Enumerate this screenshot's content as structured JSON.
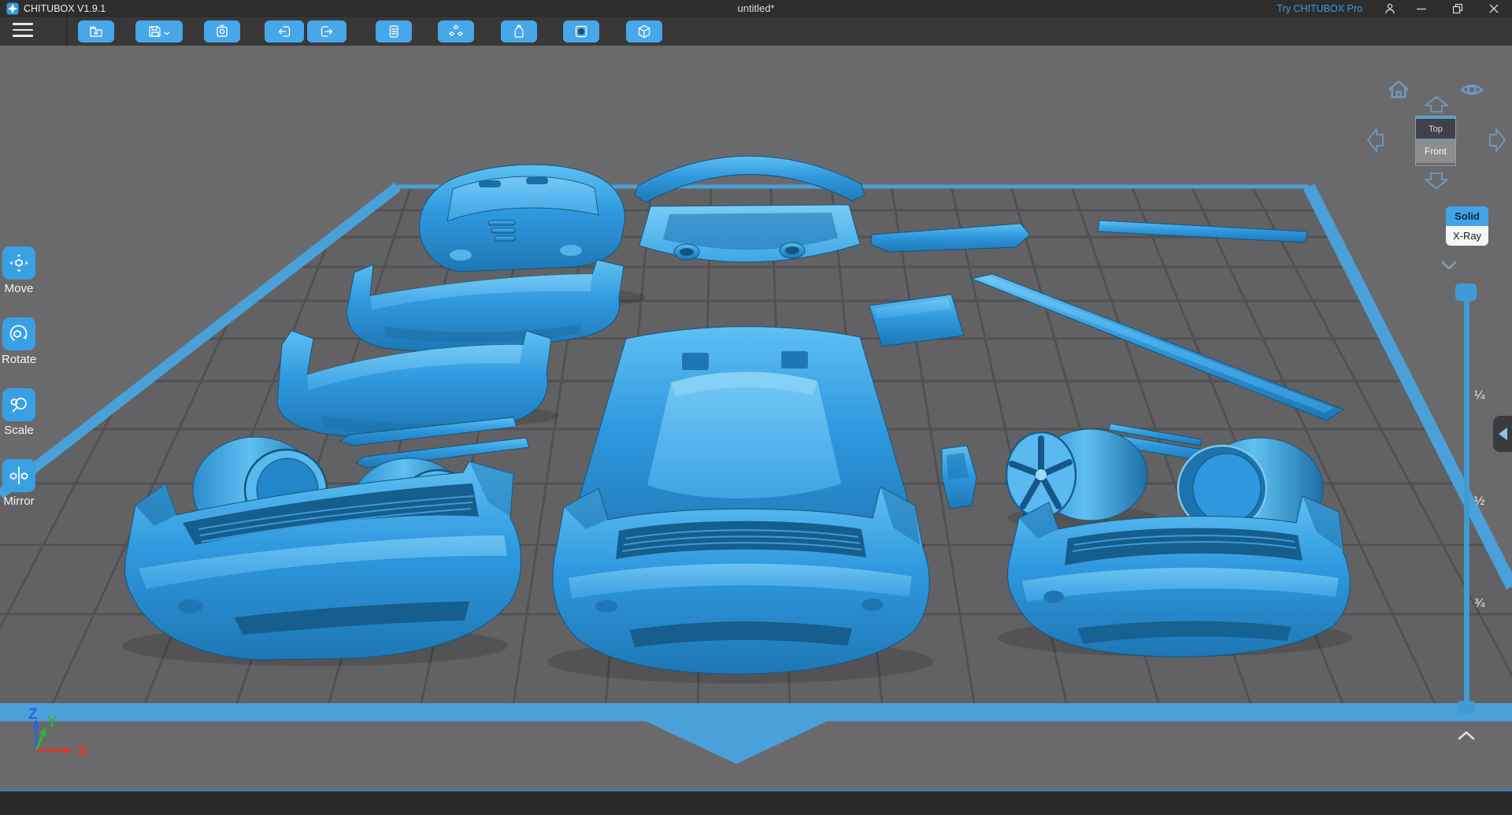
{
  "titlebar": {
    "app_title": "CHITUBOX V1.9.1",
    "document_title": "untitled*",
    "try_pro": "Try CHITUBOX Pro",
    "window_icons": [
      "account-icon",
      "minimize-icon",
      "restore-icon",
      "close-icon"
    ]
  },
  "toolbar": {
    "menu_icon": "hamburger-icon",
    "buttons": [
      {
        "icon": "open-folder-icon"
      },
      {
        "icon": "save-icon-with-dropdown"
      },
      {
        "icon": "screenshot-icon"
      },
      {
        "icon": "undo-icon"
      },
      {
        "icon": "redo-icon"
      },
      {
        "icon": "copy-icon"
      },
      {
        "icon": "auto-layout-icon"
      },
      {
        "icon": "resin-bottle-icon"
      },
      {
        "icon": "dig-hole-icon"
      },
      {
        "icon": "infill-box-icon"
      }
    ]
  },
  "tools": [
    {
      "label": "Move",
      "icon": "move-icon"
    },
    {
      "label": "Rotate",
      "icon": "rotate-icon"
    },
    {
      "label": "Scale",
      "icon": "scale-icon"
    },
    {
      "label": "Mirror",
      "icon": "mirror-icon"
    }
  ],
  "view_navigator": {
    "icons": [
      "home-icon",
      "visibility-icon",
      "arrow-up-icon",
      "arrow-down-icon",
      "arrow-left-icon",
      "arrow-right-icon"
    ],
    "cube": {
      "top_label": "Top",
      "front_label": "Front"
    }
  },
  "render_mode": {
    "options": [
      {
        "label": "Solid",
        "active": true
      },
      {
        "label": "X-Ray",
        "active": false
      }
    ]
  },
  "clip_slider": {
    "tick_labels": [
      "¼",
      "½",
      "¾"
    ]
  },
  "axis_gizmo": {
    "axes": [
      {
        "label": "X",
        "color": "#e03428"
      },
      {
        "label": "Y",
        "color": "#2fb335"
      },
      {
        "label": "Z",
        "color": "#2f62e0"
      }
    ]
  },
  "colors": {
    "accent_blue": "#42a4e8",
    "model_blue": "#2f98de",
    "titlebar_bg": "#2d2d2e",
    "toolbar_bg": "#383838",
    "viewport_bg": "#6a6a6c",
    "plate_fill": "#626264",
    "grid_line": "#515153",
    "plate_edge_blue": "#4aa0d8",
    "statusbar_bg": "#29292b",
    "statusbar_border": "#2e7fc2"
  }
}
